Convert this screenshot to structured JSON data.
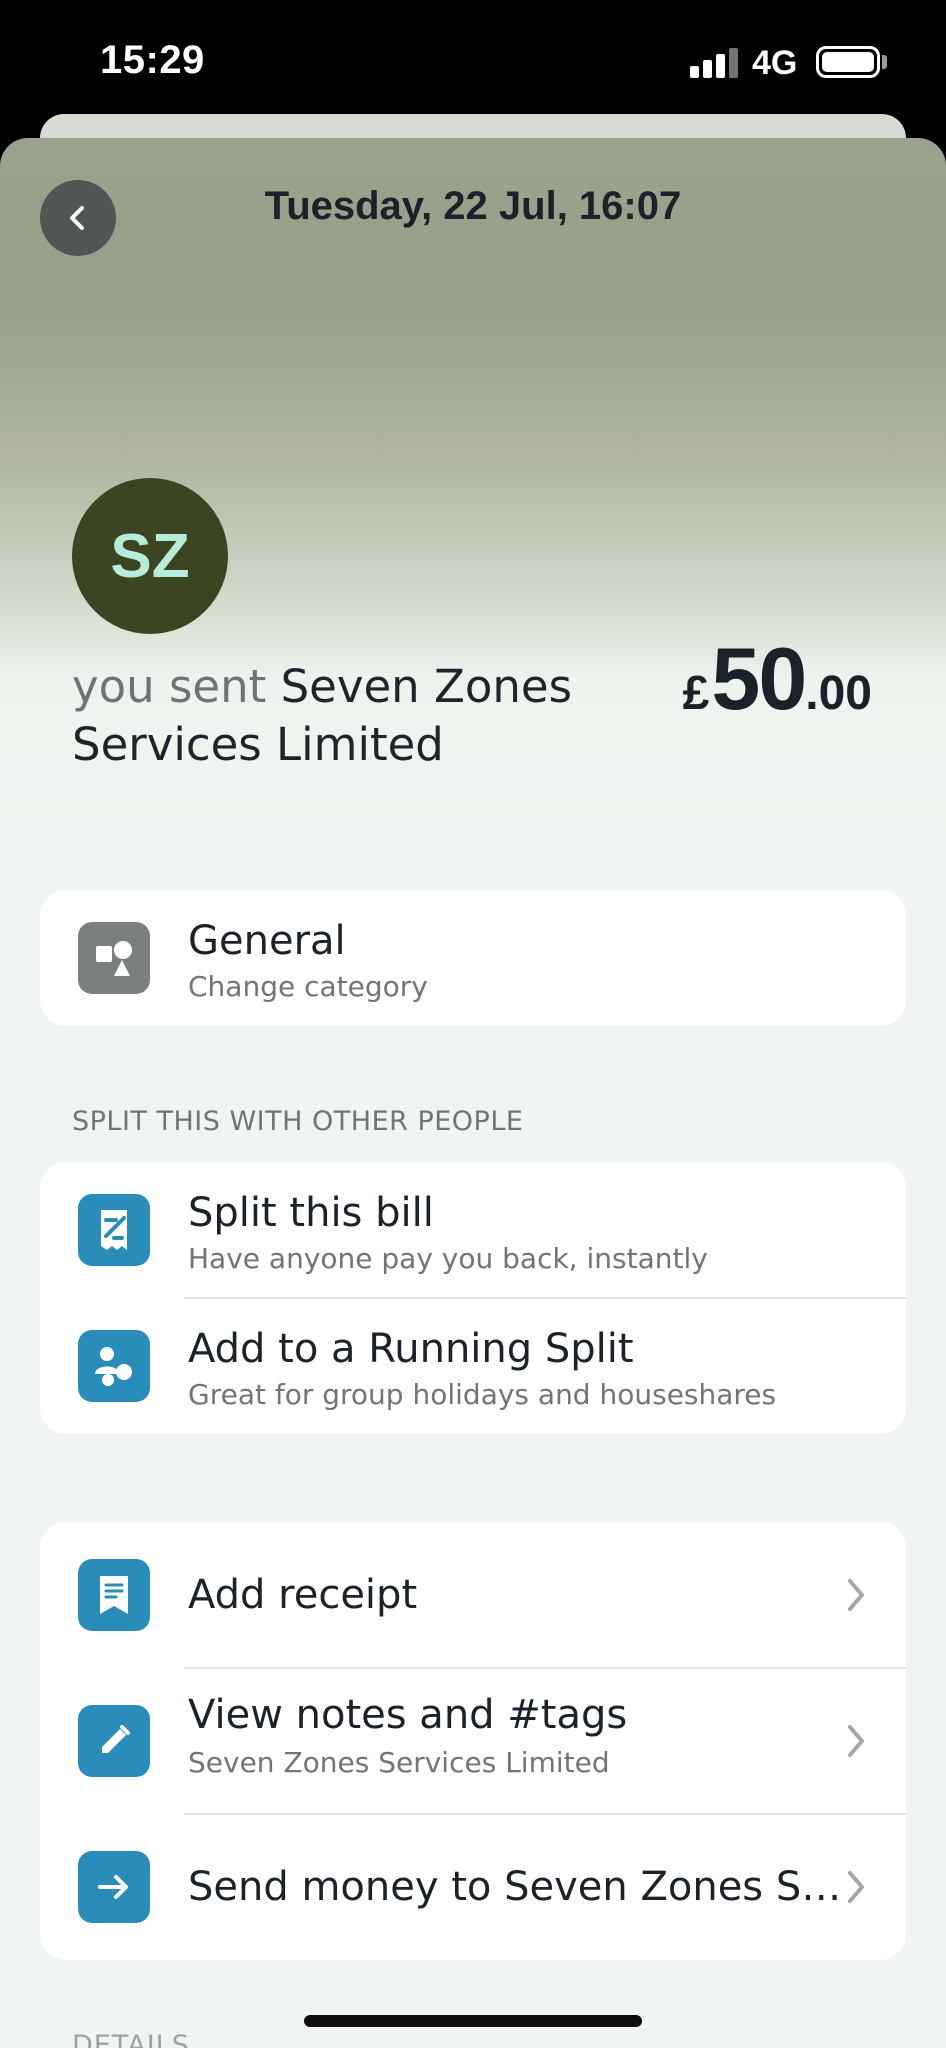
{
  "status_bar": {
    "time": "15:29",
    "network": "4G"
  },
  "header": {
    "title": "Tuesday, 22 Jul, 16:07"
  },
  "transaction": {
    "avatar_initials": "SZ",
    "avatar_color": "#3b4521",
    "direction_text": "you sent",
    "merchant_name": "Seven Zones Services Limited",
    "currency_symbol": "£",
    "amount_integer": "50",
    "amount_decimal": ".00"
  },
  "category": {
    "title": "General",
    "subtitle": "Change category",
    "icon": "shapes-icon"
  },
  "split_section": {
    "label": "SPLIT THIS WITH OTHER PEOPLE",
    "items": [
      {
        "title": "Split this bill",
        "subtitle": "Have anyone pay you back, instantly",
        "icon": "bill-split-icon"
      },
      {
        "title": "Add to a Running Split",
        "subtitle": "Great for group holidays and houseshares",
        "icon": "group-icon"
      }
    ]
  },
  "actions": {
    "items": [
      {
        "title": "Add receipt",
        "subtitle": "",
        "icon": "receipt-icon"
      },
      {
        "title": "View notes and #tags",
        "subtitle": "Seven Zones Services Limited",
        "icon": "pencil-icon"
      },
      {
        "title": "Send money to Seven Zones S…",
        "subtitle": "",
        "icon": "arrow-right-icon"
      }
    ]
  },
  "details": {
    "label": "DETAILS"
  },
  "colors": {
    "accent_blue": "#2a8db9",
    "avatar_text": "#b7ecd9"
  }
}
